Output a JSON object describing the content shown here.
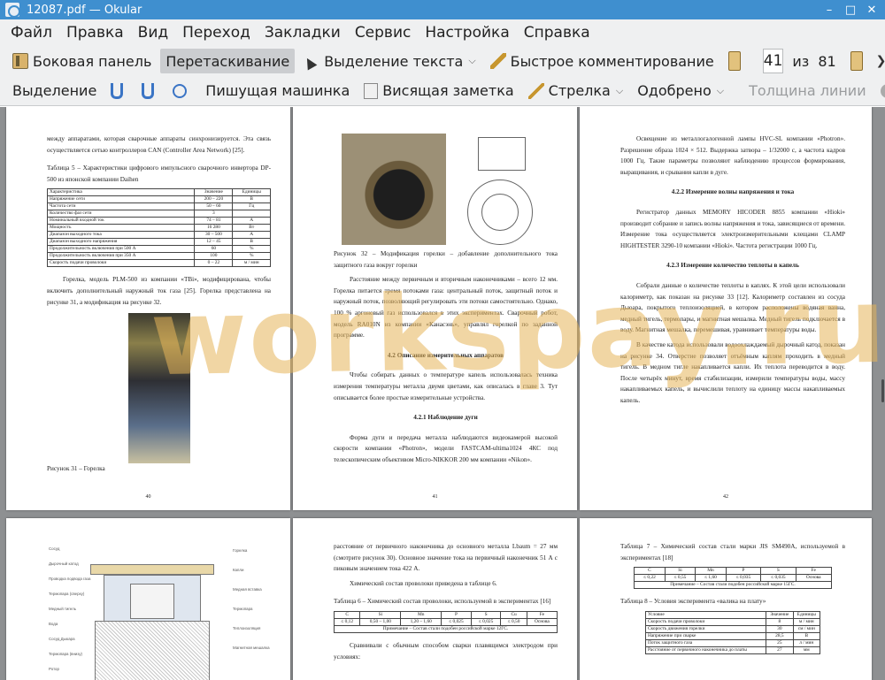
{
  "window": {
    "title": "12087.pdf — Okular",
    "min": "–",
    "max": "□",
    "close": "✕"
  },
  "menu": [
    "Файл",
    "Правка",
    "Вид",
    "Переход",
    "Закладки",
    "Сервис",
    "Настройка",
    "Справка"
  ],
  "toolbar1": {
    "sidebar": "Боковая панель",
    "drag": "Перетаскивание",
    "text_select": "Выделение текста",
    "quick_comment": "Быстрое комментирование",
    "page_current": "41",
    "page_of": "из",
    "page_total": "81",
    "overflow": "❯"
  },
  "toolbar2": {
    "highlight": "Выделение",
    "typewriter": "Пишущая машинка",
    "sticky_note": "Висящая заметка",
    "arrow": "Стрелка",
    "approved": "Одобрено",
    "line_width": "Толщина линии",
    "overflow": "❯"
  },
  "watermark": "workspay.ru",
  "pages": {
    "p40": {
      "intro": "между аппаратами, которая сварочные аппараты синхронизируется. Эта связь осуществляется сетью контроллеров CAN (Controller Area Network) [25].",
      "table_caption": "Таблица 5 – Характеристики цифрового импульсного сварочного инвертора DP-500 из японской компании Daihen",
      "table_header": [
        "Характеристика",
        "Значение",
        "Единицы"
      ],
      "table_rows": [
        [
          "Напряжение сети",
          "200 – 220",
          "В"
        ],
        [
          "Частота сети",
          "50 – 60",
          "Гц"
        ],
        [
          "Количество фаз сети",
          "3",
          ""
        ],
        [
          "Номинальный входной ток",
          "74 – 81",
          "А"
        ],
        [
          "Мощность",
          "16 280",
          "Вт"
        ],
        [
          "Диапазон выходного тока",
          "30 – 500",
          "А"
        ],
        [
          "Диапазон выходного напряжения",
          "12 – 45",
          "В"
        ],
        [
          "Продолжительность включения при 500 А",
          "60",
          "%"
        ],
        [
          "Продолжительность включения при 350 А",
          "100",
          "%"
        ],
        [
          "Скорость подачи проволоки",
          "0 – 22",
          "м / мин"
        ]
      ],
      "para": "Горелка, модель PLM-500 из компании «TBi», модифицирована, чтобы включить дополнительный наружный ток газа [25]. Горелка представлена на рисунке 31, а модификация на рисунке 32.",
      "figure_caption": "Рисунок 31 – Горелка",
      "number": "40"
    },
    "p41": {
      "figure_caption": "Рисунок 32 – Модификация горелки – добавление дополнительного тока защитного газа вокруг горелки",
      "para1": "Расстояние между первичным и вторичным наконечниками – всего 12 мм. Горелка питается тремя потоками газа: центральный поток, защитный поток и наружный поток, позволяющий регулировать эти потоки самостоятельно. Однако, 100 % аргоновый газ использовался в этих экспериментах. Сварочный робот, модель RA010N из компании «Канасэнь», управлял горелкой по заданной программе.",
      "heading1": "4.2 Описание измерительных аппаратов",
      "para2": "Чтобы собирать данных о температуре капель использовалась техника измерения температуры металла двумя цветами, как описалась в главе 3. Тут описывается более простые измерительные устройства.",
      "heading2": "4.2.1 Наблюдение дуги",
      "para3": "Форма дуги и передача металла наблюдаются видеокамерой высокой скорости компании «Photron», модели FASTCAM-ultima1024 4КС под телескопическим объективом Micro-NIKKOR 200 мм компании «Nikon».",
      "number": "41"
    },
    "p42": {
      "para1": "Освещение из металлогалогенной лампы HVC-SL компании «Photron». Разрешение образа 1024 × 512. Выдержка затвора – 1/32000 с, а частота кадров 1000 Гц. Такие параметры позволяют наблюдению процессов формирования, выращивания, и срывания капли в дуге.",
      "heading1": "4.2.2 Измерение волны напряжения и тока",
      "para2": "Регистратор данных MEMORY HICODER 8855 компании «Hioki» производит собрание и запись волны напряжения и тока, зависящиеся от времени. Измерение тока осуществляется электроизмерительными клещами CLAMP HIGHTESTER 3290-10 компании «Hioki». Частота регистрации 1000 Гц.",
      "heading2": "4.2.3 Измерение количество теплоты в капель",
      "para3": "Собрали данные о количестве теплоты в каплях. К этой цели использовали калориметр, как показан на рисунке 33 [12]. Калориметр составлен из сосуда Дьюара, покрытого теплоизоляцией, в котором расположены водяная ванна, медный тигель, термопары, и магнитная мешалка. Медный тигель подключается в воду. Магнитная мешалка, перемешивая, уравнивает температуры воды.",
      "para4": "В качестве катода использовали водоохлаждаемый дырочный катод, показан на рисунке 34. Отверстие позволяет отъёмным каплям проходить в медный тигель. В медном тигле накапливается капли. Их теплота переводится в воду. После четырёх минут, время стабилизации, измерили температуры воды, массу накапливаемых капель, и вычислили теплоту на единицу массы накапливаемых капель.",
      "number": "42"
    },
    "p43": {
      "labels_left": [
        "Сосуд",
        "Дырочный катод",
        "Проводка подвода газа",
        "Термопара (сверху)",
        "Медный тигель",
        "Вода",
        "Сосуд Дьюара",
        "Термопара (внизу)",
        "Ротор"
      ],
      "labels_right": [
        "Горелка",
        "Капли",
        "Медная вставка",
        "Термопара",
        "Теплоизоляция",
        "Магнитная мешалка"
      ]
    },
    "p44": {
      "para1": "расстояние от первичного наконечника до основного металла Lbaum = 27 мм (смотрите рисунок 30). Основное значение тока на первичный наконечник 51 А с пиковым значением тока 422 А.",
      "para2": "Химический состав проволоки приведена в таблице 6.",
      "table_caption": "Таблица 6 – Химический состав проволоки, используемой в экспериментах [16]",
      "table_header": [
        "C",
        "Si",
        "Mn",
        "P",
        "S",
        "Cu",
        "Fe"
      ],
      "table_row": [
        "≤ 0,12",
        "0,50 – 1,00",
        "1,20 – 1,60",
        "≤ 0,025",
        "≤ 0,025",
        "≤ 0,50",
        "Основа"
      ],
      "table_note": "Примечание – Состав стали подобен российской марке 12ГС.",
      "para3": "Сравнивали с обычным способом сварки плавящимся электродом при условиях:"
    },
    "p45": {
      "table7_caption": "Таблица 7 – Химический состав стали марки JIS SM490A, используемой в экспериментах [18]",
      "table7_header": [
        "C",
        "Si",
        "Mn",
        "P",
        "S",
        "Fe"
      ],
      "table7_row": [
        "≤ 0,22",
        "≤ 0,55",
        "≤ 1,60",
        "≤ 0,035",
        "≤ 0,035",
        "Основа"
      ],
      "table7_note": "Примечание – Состав стали подобен российской марке 15ГС.",
      "table8_caption": "Таблица 8 – Условия эксперимента «валика на плату»",
      "table8_header": [
        "Условие",
        "Значение",
        "Единицы"
      ],
      "table8_rows": [
        [
          "Скорость подачи проволоки",
          "8",
          "м / мин"
        ],
        [
          "Скорость движения горелки",
          "30",
          "см / мин"
        ],
        [
          "Напряжение при сварке",
          "28,5",
          "В"
        ],
        [
          "Поток защитного газа",
          "25",
          "л / мин"
        ],
        [
          "Расстояние от первичного наконечника до платы",
          "27",
          "мм"
        ]
      ]
    }
  }
}
